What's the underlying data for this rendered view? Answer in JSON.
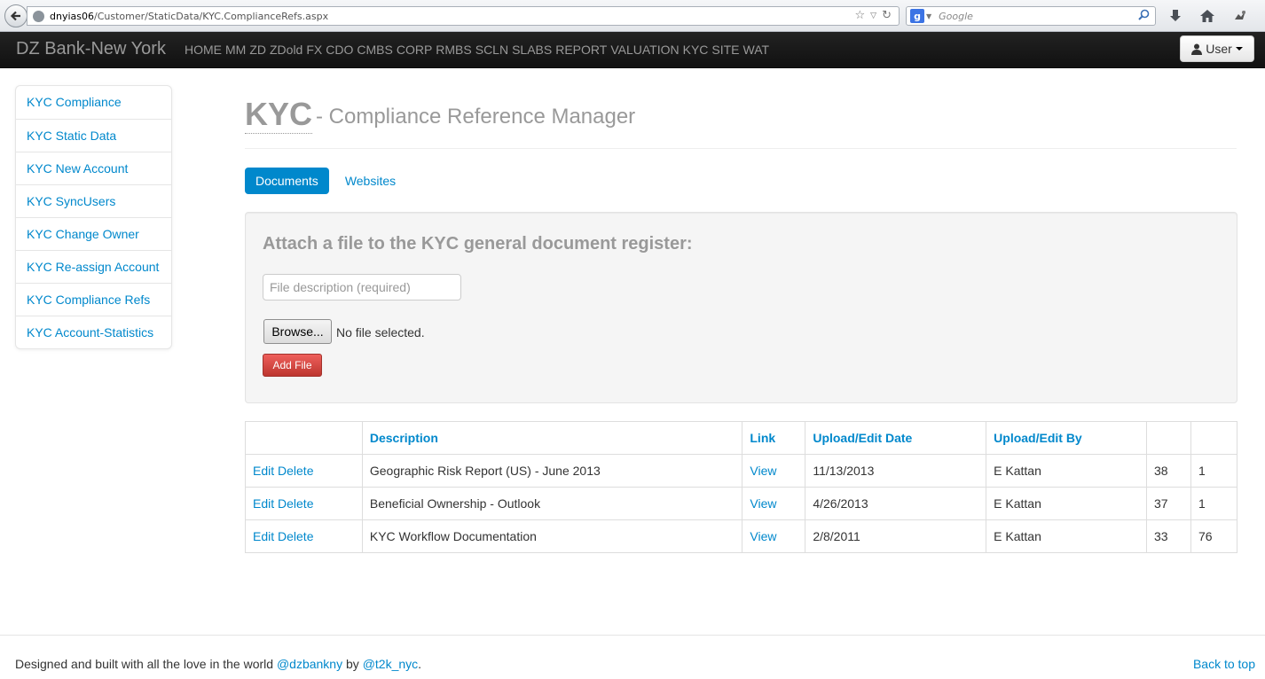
{
  "browser": {
    "url_host": "dnyias06",
    "url_path": "/Customer/StaticData/KYC.ComplianceRefs.aspx",
    "search_placeholder": "Google"
  },
  "navbar": {
    "brand": "DZ Bank-New York",
    "links": [
      "HOME",
      "MM",
      "ZD",
      "ZDold",
      "FX",
      "CDO",
      "CMBS",
      "CORP",
      "RMBS",
      "SCLN",
      "SLABS",
      "REPORT",
      "VALUATION",
      "KYC",
      "SITE",
      "WAT"
    ],
    "user_label": "User"
  },
  "sidebar": {
    "items": [
      {
        "label": "KYC Compliance"
      },
      {
        "label": "KYC Static Data"
      },
      {
        "label": "KYC New Account"
      },
      {
        "label": "KYC SyncUsers"
      },
      {
        "label": "KYC Change Owner"
      },
      {
        "label": "KYC Re-assign Account"
      },
      {
        "label": "KYC Compliance Refs"
      },
      {
        "label": "KYC Account-Statistics"
      }
    ]
  },
  "header": {
    "title": "KYC",
    "subtitle": "- Compliance Reference Manager"
  },
  "tabs": [
    {
      "label": "Documents",
      "active": true
    },
    {
      "label": "Websites",
      "active": false
    }
  ],
  "upload": {
    "heading": "Attach a file to the KYC general document register:",
    "description_placeholder": "File description (required)",
    "description_value": "",
    "browse_label": "Browse...",
    "no_file_text": "No file selected.",
    "add_label": "Add File"
  },
  "table": {
    "headers": [
      "",
      "Description",
      "Link",
      "Upload/Edit Date",
      "Upload/Edit By",
      "",
      ""
    ],
    "rows": [
      {
        "edit": "Edit",
        "delete": "Delete",
        "description": "Geographic Risk Report (US) - June 2013",
        "link": "View",
        "date": "11/13/2013",
        "by": "E Kattan",
        "id": "38",
        "count": "1"
      },
      {
        "edit": "Edit",
        "delete": "Delete",
        "description": "Beneficial Ownership - Outlook",
        "link": "View",
        "date": "4/26/2013",
        "by": "E Kattan",
        "id": "37",
        "count": "1"
      },
      {
        "edit": "Edit",
        "delete": "Delete",
        "description": "KYC Workflow Documentation",
        "link": "View",
        "date": "2/8/2011",
        "by": "E Kattan",
        "id": "33",
        "count": "76"
      }
    ]
  },
  "footer": {
    "text": "Designed and built with all the love in the world",
    "handle1": "@dzbankny",
    "by": "by",
    "handle2": "@t2k_nyc",
    "period": ".",
    "back_to_top": "Back to top"
  },
  "colors": {
    "link": "#0088cc",
    "navbar": "#1b1b1b",
    "danger": "#bd362f"
  }
}
